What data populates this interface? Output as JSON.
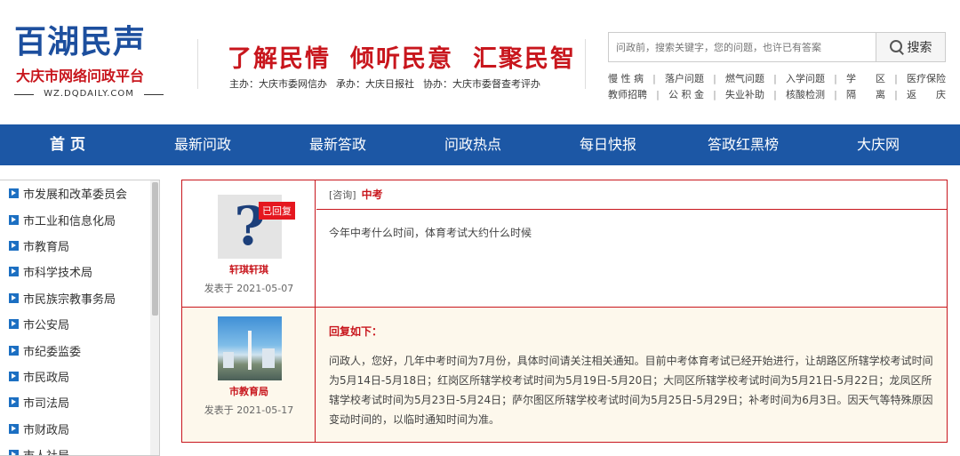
{
  "logo": {
    "main": "百湖民声",
    "sub": "大庆市网络问政平台",
    "url": "WZ.DQDAILY.COM"
  },
  "slogan": [
    "了解民情",
    "倾听民意",
    "汇聚民智"
  ],
  "orgs": [
    "主办：大庆市委网信办",
    "承办：大庆日报社",
    "协办：大庆市委督查考评办"
  ],
  "search": {
    "placeholder": "问政前，搜索关键字，您的问题，也许已有答案",
    "button_label": "搜索"
  },
  "hot_tags": {
    "row1": [
      "慢 性 病",
      "落户问题",
      "燃气问题",
      "入学问题",
      "学　　区",
      "医疗保险"
    ],
    "row2": [
      "教师招聘",
      "公 积 金",
      "失业补助",
      "核酸检测",
      "隔　　离",
      "返　　庆"
    ]
  },
  "nav": [
    "首 页",
    "最新问政",
    "最新答政",
    "问政热点",
    "每日快报",
    "答政红黑榜",
    "大庆网"
  ],
  "sidebar": [
    "市发展和改革委员会",
    "市工业和信息化局",
    "市教育局",
    "市科学技术局",
    "市民族宗教事务局",
    "市公安局",
    "市纪委监委",
    "市民政局",
    "市司法局",
    "市财政局",
    "市人社局"
  ],
  "question": {
    "badge": "已回复",
    "user": "轩琪轩琪",
    "date": "发表于 2021-05-07",
    "type": "[咨询]",
    "title": "中考",
    "content": "今年中考什么时间，体育考试大约什么时候"
  },
  "answer": {
    "org": "市教育局",
    "date": "发表于 2021-05-17",
    "head": "回复如下：",
    "body": "问政人，您好，几年中考时间为7月份，具体时间请关注相关通知。目前中考体育考试已经开始进行，让胡路区所辖学校考试时间为5月14日-5月18日；红岗区所辖学校考试时间为5月19日-5月20日；大同区所辖学校考试时间为5月21日-5月22日；龙凤区所辖学校考试时间为5月23日-5月24日；萨尔图区所辖学校考试时间为5月25日-5月29日；补考时间为6月3日。因天气等特殊原因变动时间的，以临时通知时间为准。"
  }
}
